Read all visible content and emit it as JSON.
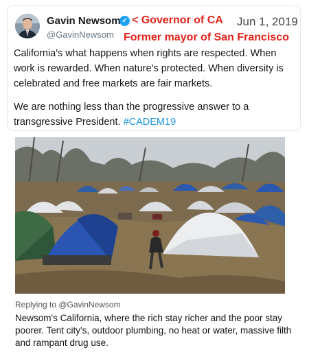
{
  "tweet": {
    "display_name": "Gavin Newsom",
    "verified_icon": "verified-badge-icon",
    "handle": "@GavinNewsom",
    "date": "Jun 1, 2019",
    "paragraph1": "California's what happens when rights are respected. When work is rewarded. When nature's protected. When diversity is celebrated and free markets are fair markets.",
    "paragraph2_text": "We are nothing less than the progressive answer to a transgressive President.",
    "hashtag": "#CADEM19",
    "hashtag_color": "#1b95e0"
  },
  "annotations": {
    "line1": "< Governor of CA",
    "line2": "Former mayor of San Francisco",
    "color": "#e2231a"
  },
  "reply": {
    "replying_to": "Replying to @GavinNewsom",
    "text": "Newsom's California, where the rich stay richer and the poor stay poorer.  Tent city's, outdoor plumbing, no heat or water, massive filth and rampant drug use."
  }
}
